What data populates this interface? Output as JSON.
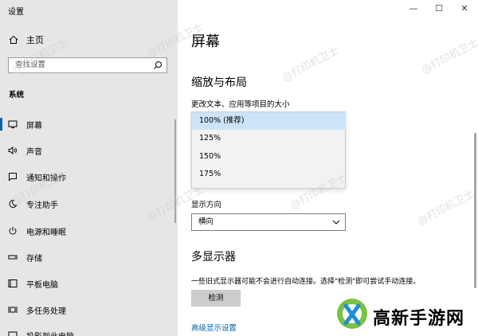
{
  "window": {
    "title": "设置"
  },
  "window_controls": [
    "—",
    "☐",
    "✕"
  ],
  "sidebar": {
    "home_label": "主页",
    "search_placeholder": "查找设置",
    "section_label": "系统",
    "items": [
      {
        "label": "屏幕",
        "icon": "monitor-icon"
      },
      {
        "label": "声音",
        "icon": "speaker-icon"
      },
      {
        "label": "通知和操作",
        "icon": "notification-icon"
      },
      {
        "label": "专注助手",
        "icon": "moon-icon"
      },
      {
        "label": "电源和睡眠",
        "icon": "power-icon"
      },
      {
        "label": "存储",
        "icon": "storage-icon"
      },
      {
        "label": "平板电脑",
        "icon": "tablet-icon"
      },
      {
        "label": "多任务处理",
        "icon": "multitask-icon"
      },
      {
        "label": "投影到此电脑",
        "icon": "project-icon"
      }
    ]
  },
  "main": {
    "page_title": "屏幕",
    "scale_section": "缩放与布局",
    "text_size_label": "更改文本、应用等项目的大小",
    "scale_options": [
      "100% (推荐)",
      "125%",
      "150%",
      "175%"
    ],
    "orientation_label": "显示方向",
    "orientation_value": "横向",
    "multi_display_section": "多显示器",
    "multi_display_desc": "一些旧式显示器可能不会进行自动连接。选择\"检测\"即可尝试手动连接。",
    "detect_button": "检测",
    "advanced_link": "高级显示设置"
  },
  "watermark_text": "@打印机卫士",
  "brand": {
    "logo_text": "高新手游网",
    "green": "#7cc242",
    "blue": "#1f8fd6"
  }
}
